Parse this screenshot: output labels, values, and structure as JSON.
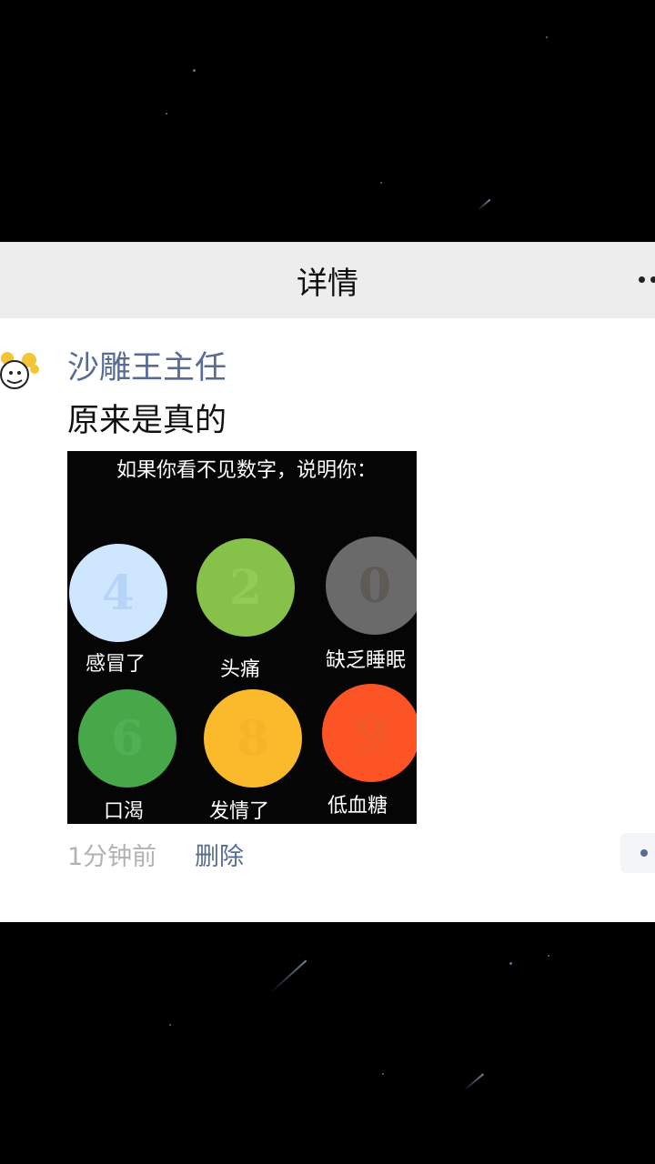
{
  "header": {
    "title": "详情"
  },
  "post": {
    "username": "沙雕王主任",
    "text": "原来是真的",
    "image": {
      "caption": "如果你看不见数字，说明你：",
      "circles": [
        {
          "digit": "4",
          "label": "感冒了",
          "color": "#cfe6ff",
          "digit_color": "#b6d4f7"
        },
        {
          "digit": "2",
          "label": "头痛",
          "color": "#86c24a",
          "digit_color": "#93cb57"
        },
        {
          "digit": "0",
          "label": "缺乏睡眠",
          "color": "#6a6a6a",
          "digit_color": "#5e5a56"
        },
        {
          "digit": "6",
          "label": "口渴",
          "color": "#47a84a",
          "digit_color": "#52b054"
        },
        {
          "digit": "8",
          "label": "发情了",
          "color": "#fbb92c",
          "digit_color": "#f4b52a"
        },
        {
          "digit": "9",
          "label": "低血糖",
          "color": "#fc5424",
          "digit_color": "#f25a28"
        }
      ]
    },
    "timestamp": "1分钟前",
    "delete_label": "删除"
  },
  "icons": {
    "more": "more-dots-icon",
    "comment": "comment-dots-icon"
  },
  "colors": {
    "link": "#576b95",
    "header_bg": "#ededed",
    "timestamp": "#b2b2b2"
  }
}
